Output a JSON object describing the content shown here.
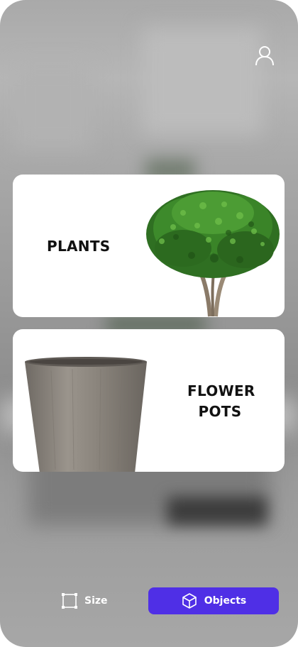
{
  "header": {
    "profile_icon": "user-icon"
  },
  "categories": [
    {
      "label": "PLANTS",
      "image": "tree-image"
    },
    {
      "label_line1": "FLOWER",
      "label_line2": "POTS",
      "image": "pot-image"
    }
  ],
  "bottom_bar": {
    "size": {
      "label": "Size",
      "icon": "resize-frame-icon"
    },
    "objects": {
      "label": "Objects",
      "icon": "cube-icon",
      "color": "#4f2fe6"
    }
  }
}
